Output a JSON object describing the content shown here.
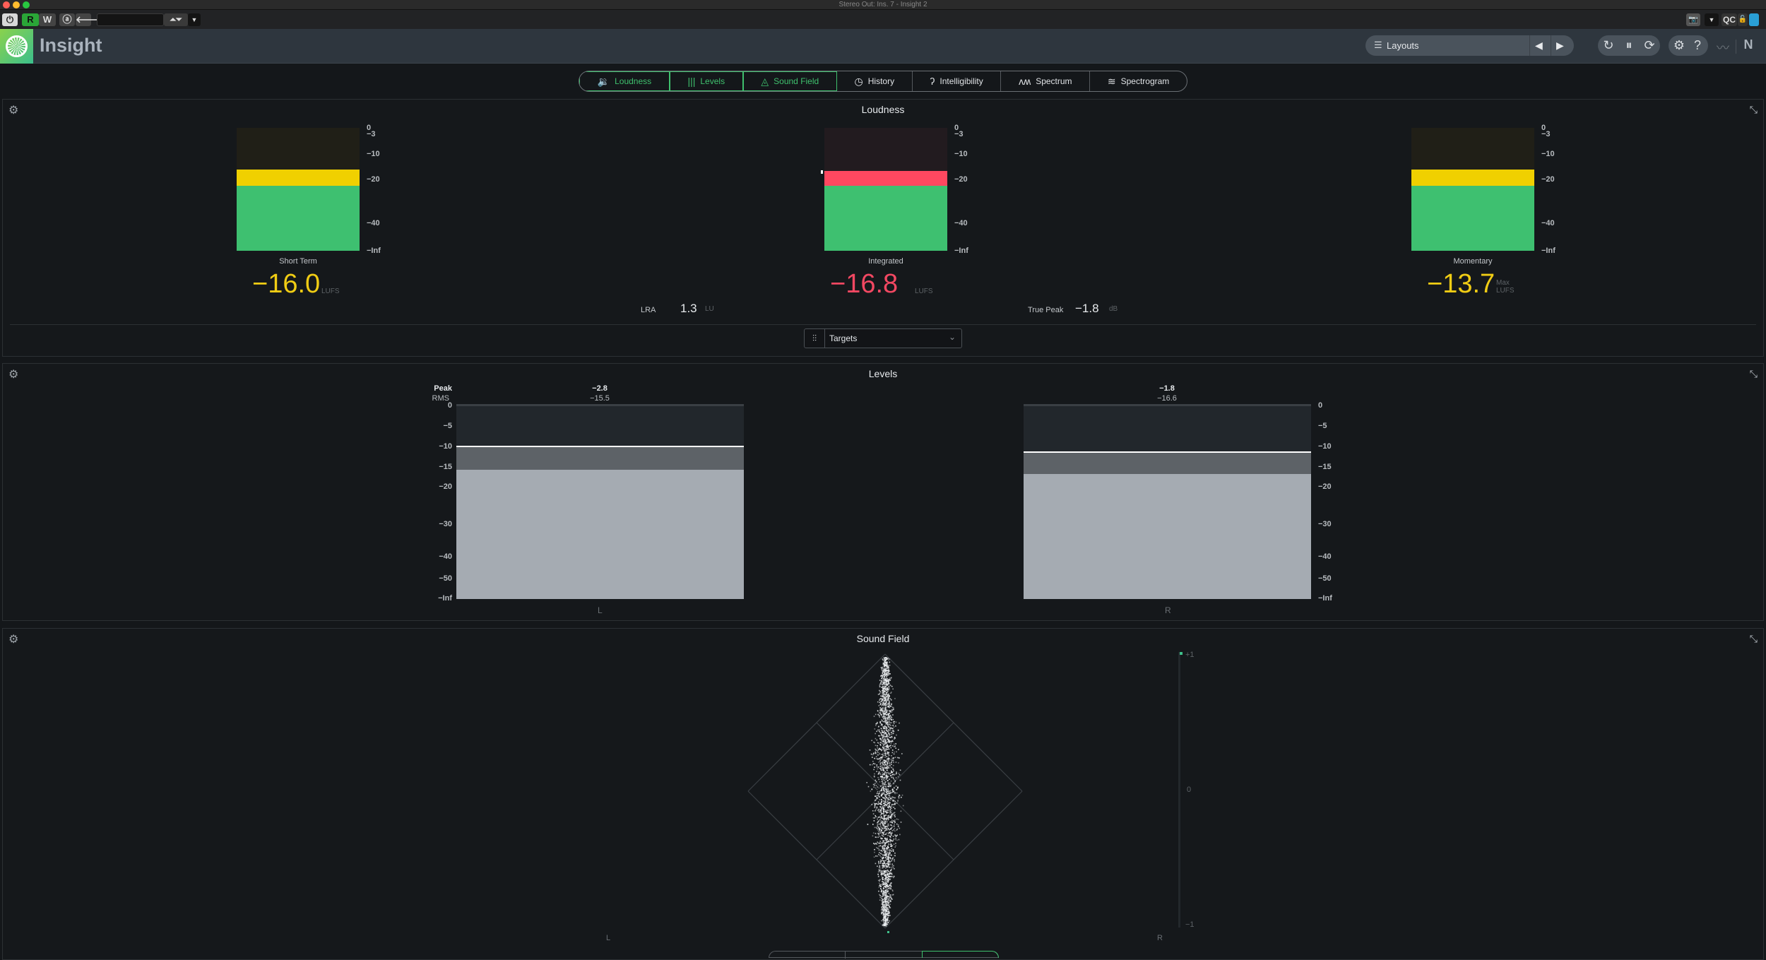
{
  "window": {
    "title": "Stereo Out: Ins. 7 - Insight 2",
    "traffic_lights": [
      "#fe5f57",
      "#febc2e",
      "#28c840"
    ]
  },
  "daw_toolbar": {
    "power_icon": "power-icon",
    "read_label": "R",
    "write_label": "W",
    "compare_icon": "a-icon",
    "back_icon": "arrow-left-icon",
    "preset_value": "",
    "right": {
      "snapshot_icon": "camera-icon",
      "qc_label": "QC",
      "lock_icon": "lock-open-icon",
      "color_swatch": "#2a9fd6"
    }
  },
  "header": {
    "app_name": "Insight",
    "layouts_label": "Layouts",
    "prev_icon": "◀",
    "next_icon": "▶",
    "icons": [
      "reset-icon",
      "pause-icon",
      "sync-icon",
      "gear-icon",
      "help-icon",
      "signal-icon",
      "ni-logo-icon"
    ]
  },
  "tabs": [
    {
      "label": "Loudness",
      "icon": "speaker-icon",
      "glyph": "🔈",
      "active": true
    },
    {
      "label": "Levels",
      "icon": "levels-icon",
      "glyph": "⦀",
      "active": true
    },
    {
      "label": "Sound Field",
      "icon": "sound-field-icon",
      "glyph": "⏶",
      "active": true
    },
    {
      "label": "History",
      "icon": "history-icon",
      "glyph": "⟲",
      "active": false
    },
    {
      "label": "Intelligibility",
      "icon": "ear-icon",
      "glyph": "ʔ",
      "active": false
    },
    {
      "label": "Spectrum",
      "icon": "spectrum-icon",
      "glyph": "ʌʍ",
      "active": false
    },
    {
      "label": "Spectrogram",
      "icon": "spectrogram-icon",
      "glyph": "≋",
      "active": false
    }
  ],
  "loudness": {
    "title": "Loudness",
    "scale_labels": [
      "0",
      "−3",
      "−10",
      "−20",
      "−40",
      "−Inf"
    ],
    "meters": [
      {
        "label": "Short Term",
        "value": "−16.0",
        "unit": "LUFS",
        "level_lufs": -16.0,
        "upper_color": "#f0d000",
        "bg_color": "#201f17",
        "value_color": "#f0cc14"
      },
      {
        "label": "Integrated",
        "value": "−16.8",
        "unit": "LUFS",
        "level_lufs": -16.8,
        "upper_color": "#ff4860",
        "bg_color": "#221b1f",
        "value_color": "#f24862"
      },
      {
        "label": "Momentary",
        "value": "−13.7",
        "unit_line1": "Max",
        "unit_line2": "LUFS",
        "level_lufs": -16.2,
        "upper_color": "#f0d000",
        "bg_color": "#201f17",
        "value_color": "#f0cc14"
      }
    ],
    "lra": {
      "label": "LRA",
      "value": "1.3",
      "unit": "LU"
    },
    "true_peak": {
      "label": "True Peak",
      "value": "−1.8",
      "unit": "dB"
    },
    "targets_label": "Targets"
  },
  "levels": {
    "title": "Levels",
    "peak_label": "Peak",
    "rms_label": "RMS",
    "scale_labels": [
      "0",
      "−5",
      "−10",
      "−15",
      "−20",
      "−30",
      "−40",
      "−50",
      "−Inf"
    ],
    "channels": [
      {
        "name": "L",
        "peak": "−2.8",
        "rms": "−15.5",
        "peak_db": -9.6,
        "rms_db": -15.5
      },
      {
        "name": "R",
        "peak": "−1.8",
        "rms": "−16.6",
        "peak_db": -11.1,
        "rms_db": -16.6
      }
    ]
  },
  "sound_field": {
    "title": "Sound Field",
    "left_label": "L",
    "right_label": "R",
    "correlation_labels": [
      "+1",
      "0",
      "−1"
    ],
    "correlation_value": 1.0
  }
}
